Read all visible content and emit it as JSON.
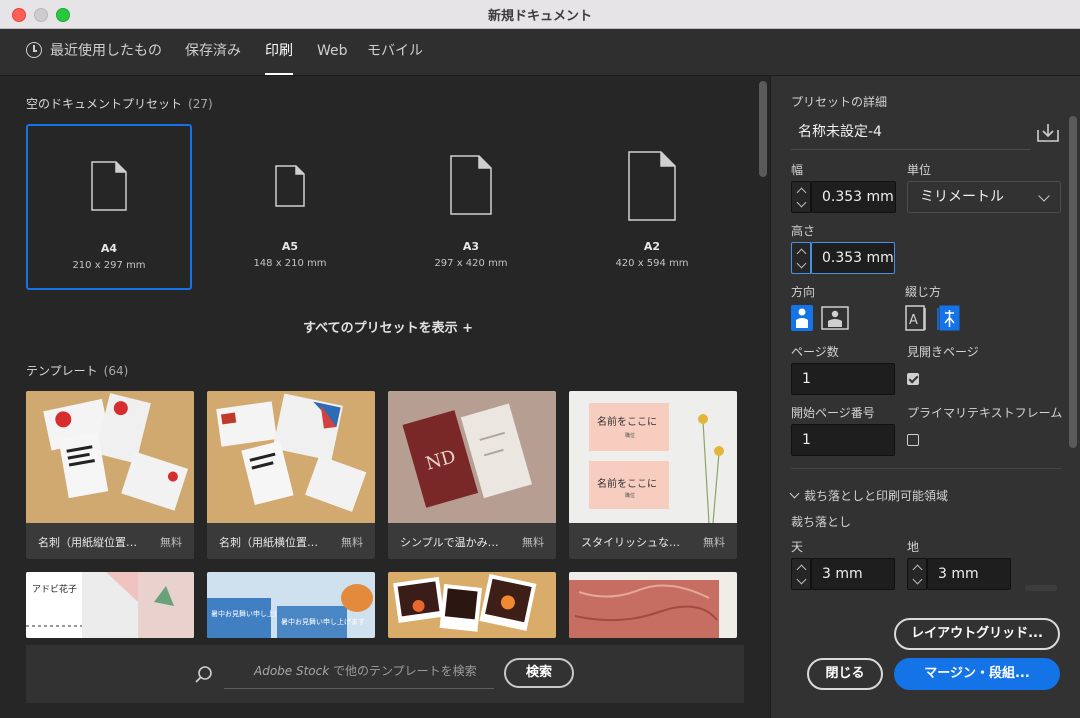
{
  "window": {
    "title": "新規ドキュメント"
  },
  "tabs": [
    {
      "label": "最近使用したもの"
    },
    {
      "label": "保存済み"
    },
    {
      "label": "印刷",
      "active": true
    },
    {
      "label": "Web"
    },
    {
      "label": "モバイル"
    }
  ],
  "presets_section": {
    "title": "空のドキュメントプリセット",
    "count": "(27)"
  },
  "presets": [
    {
      "name": "A4",
      "dims": "210 x 297 mm",
      "selected": true
    },
    {
      "name": "A5",
      "dims": "148 x 210 mm"
    },
    {
      "name": "A3",
      "dims": "297 x 420 mm"
    },
    {
      "name": "A2",
      "dims": "420 x 594 mm"
    }
  ],
  "show_all": "すべてのプリセットを表示 +",
  "templates_section": {
    "title": "テンプレート",
    "count": "(64)"
  },
  "templates": [
    {
      "label": "名刺（用紙縦位置…",
      "price": "無料"
    },
    {
      "label": "名刺（用紙横位置…",
      "price": "無料"
    },
    {
      "label": "シンプルで温かみ…",
      "price": "無料"
    },
    {
      "label": "スタイリッシュな…",
      "price": "無料"
    }
  ],
  "template_previews": {
    "card3_monogram": "ND",
    "card4_line": "名前をここに",
    "card4_sub": "職位",
    "card5_name": "アドビ花子",
    "card6_text": "暑中お見舞い申し上げます"
  },
  "stock": {
    "placeholder_brand": "Adobe Stock",
    "placeholder_rest": " で他のテンプレートを検索",
    "search_button": "検索"
  },
  "details": {
    "header": "プリセットの詳細",
    "doc_name": "名称未設定-4",
    "width_label": "幅",
    "width_value": "0.353 mm",
    "unit_label": "単位",
    "unit_value": "ミリメートル",
    "height_label": "高さ",
    "height_value": "0.353 mm",
    "orientation_label": "方向",
    "binding_label": "綴じ方",
    "pages_label": "ページ数",
    "pages_value": "1",
    "facing_label": "見開きページ",
    "facing_checked": true,
    "start_page_label": "開始ページ番号",
    "start_page_value": "1",
    "primary_text_label": "プライマリテキストフレーム",
    "primary_text_checked": false,
    "bleed_section": "裁ち落としと印刷可能領域",
    "bleed_label": "裁ち落とし",
    "top_label": "天",
    "top_value": "3 mm",
    "bottom_label": "地",
    "bottom_value": "3 mm"
  },
  "buttons": {
    "layout_grid": "レイアウトグリッド...",
    "close": "閉じる",
    "margins": "マージン・段組..."
  },
  "colors": {
    "accent": "#1473e6",
    "background": "#262626",
    "panel": "#323232"
  }
}
